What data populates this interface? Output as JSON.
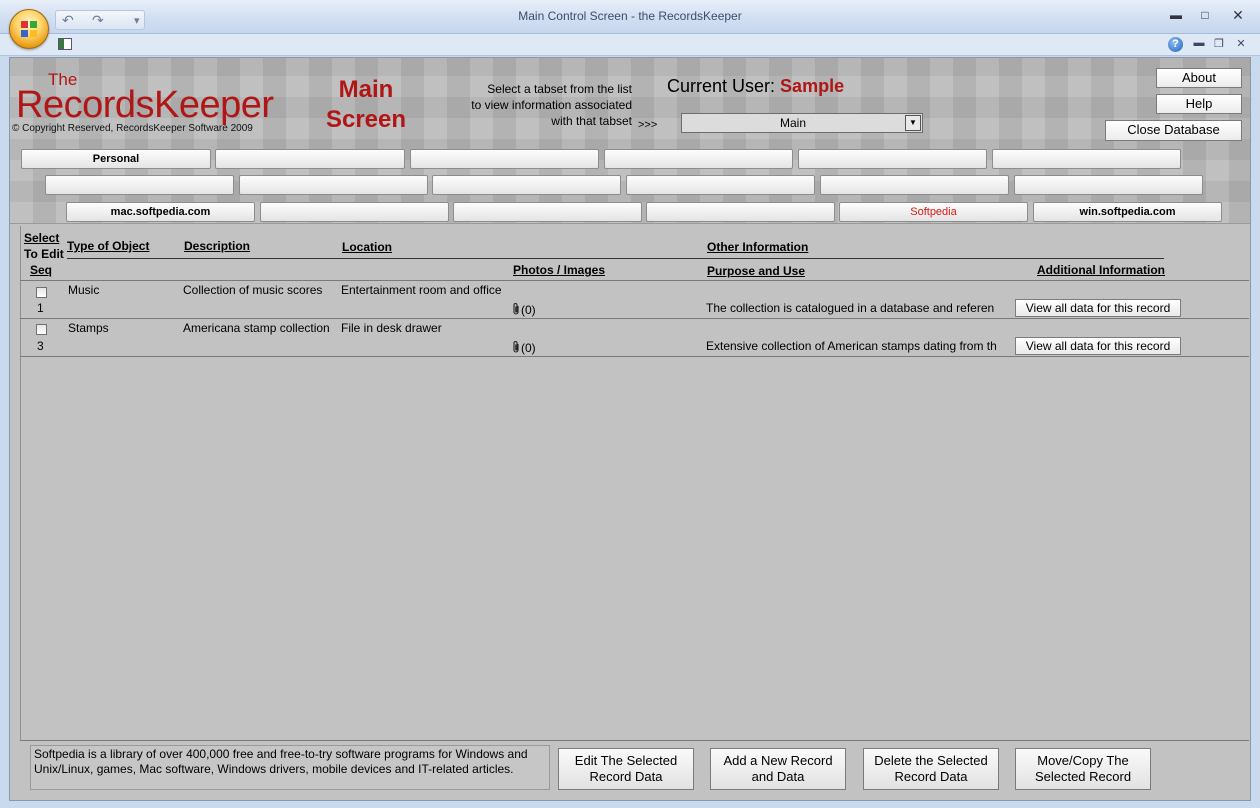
{
  "window": {
    "title": "Main Control Screen - the RecordsKeeper",
    "undo": "↶",
    "redo": "↷",
    "qat_customize": "▾",
    "minimize": "▬",
    "maximize": "□",
    "close": "✕",
    "help": "?",
    "inner_minimize": "▬",
    "inner_restore": "❐",
    "inner_close": "✕"
  },
  "header": {
    "brand_the": "The",
    "brand_name": "RecordsKeeper",
    "copyright": "© Copyright Reserved, RecordsKeeper Software  2009",
    "main_screen_line1": "Main",
    "main_screen_line2": "Screen",
    "select_hint_line1": "Select a tabset from the list",
    "select_hint_line2": "to view information associated",
    "select_hint_line3": "with that tabset",
    "arrows": ">>>",
    "current_user_label": "Current User:",
    "current_user_value": "Sample",
    "tabset_value": "Main",
    "about": "About",
    "help": "Help",
    "close_db": "Close Database"
  },
  "tabs": {
    "row1": [
      "Personal",
      "",
      "",
      "",
      "",
      ""
    ],
    "row2": [
      "",
      "",
      "",
      "",
      "",
      ""
    ],
    "row3": [
      "mac.softpedia.com",
      "",
      "",
      "",
      "Softpedia",
      "win.softpedia.com"
    ]
  },
  "columns": {
    "select_line1": "Select",
    "select_line2": "To Edit",
    "seq": "Seq",
    "type": "Type of Object",
    "description": "Description",
    "location": "Location",
    "photos": "Photos / Images",
    "other": "Other Information",
    "purpose": "Purpose and Use",
    "additional": "Additional Information"
  },
  "records": [
    {
      "seq": "1",
      "type": "Music",
      "description": "Collection of music scores",
      "location": "Entertainment room and office",
      "photos": "(0)",
      "purpose": "The collection is catalogued in a database and referen",
      "view": "View all data for this record"
    },
    {
      "seq": "3",
      "type": "Stamps",
      "description": "Americana stamp collection",
      "location": "File in desk drawer",
      "photos": "(0)",
      "purpose": "Extensive collection of American stamps dating from th",
      "view": "View all data for this record"
    }
  ],
  "footer": {
    "info": "Softpedia is a library of over 400,000 free and free-to-try software programs for Windows and Unix/Linux, games, Mac software, Windows drivers, mobile devices and IT-related articles.",
    "edit_l1": "Edit The Selected",
    "edit_l2": "Record Data",
    "add_l1": "Add a New Record",
    "add_l2": "and Data",
    "delete_l1": "Delete the Selected",
    "delete_l2": "Record Data",
    "move_l1": "Move/Copy The",
    "move_l2": "Selected Record"
  },
  "colors": {
    "brand_red": "#b01616",
    "tab_red": "#d21818",
    "background": "#c2c2c2"
  }
}
